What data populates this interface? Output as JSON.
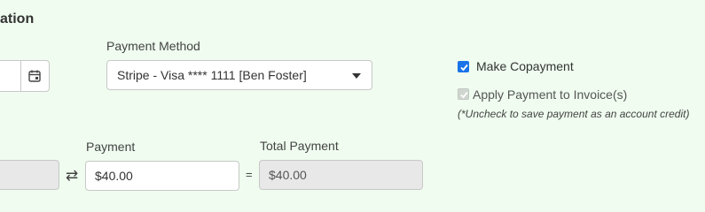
{
  "section": {
    "title": "ation"
  },
  "payment_method": {
    "label": "Payment Method",
    "selected": "Stripe - Visa **** 1111 [Ben Foster]"
  },
  "options": {
    "make_copayment": {
      "label": "Make Copayment",
      "checked": true
    },
    "apply_to_invoice": {
      "label": "Apply Payment to Invoice(s)",
      "checked": true,
      "disabled": true
    },
    "hint": "(*Uncheck to save payment as an account credit)"
  },
  "payment": {
    "label": "Payment",
    "value": "$40.00"
  },
  "total_payment": {
    "label": "Total Payment",
    "value": "$40.00"
  },
  "operators": {
    "swap": "⇄",
    "equals": "="
  },
  "colors": {
    "background": "#effcef",
    "checkbox": "#1a73e8"
  }
}
